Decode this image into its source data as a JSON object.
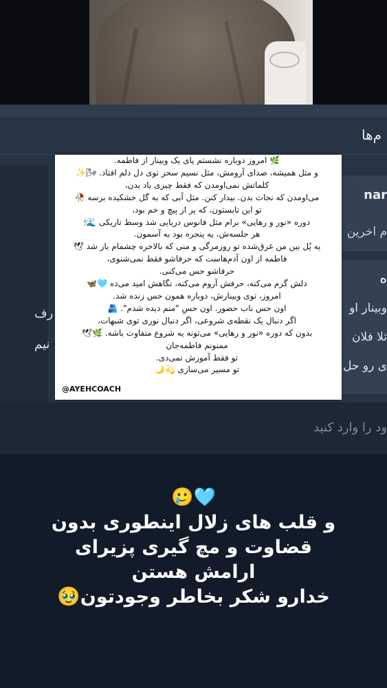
{
  "header": {
    "title": "م‌ها"
  },
  "chat_list": {
    "preview_name": "nar",
    "preview_message": "م اخرین"
  },
  "message_card": {
    "heading": "ه",
    "line1": "وبینار او",
    "line2": "ثلا فلان",
    "line3": "ی رو حل"
  },
  "left_fragments": {
    "line1": "رف",
    "line2": "نیم"
  },
  "input": {
    "placeholder": "ود را وارد کنید"
  },
  "quote_card": {
    "lines": [
      "🌿 امروز دوباره نشستم پای یک وبینار از فاطمه.",
      "و مثل همیشه، صدای آرومش، مثل نسیم سحر توی دل دلم افتاد. 🌬✨",
      "کلماتش نمی‌اومدن که فقط چیزی یاد بدن،",
      "می‌اومدن که نجات بدن. بیدار کنن. مثل آبی که به گل خشکیده برسه 🥀",
      "تو این تابستون، که پر از پیچ و خم بود،",
      "دوره «نور و رهایی» برام مثل فانوس دریایی شد وسط تاریکی 🌊🕯",
      "هر جلسه‌ش، یه پنجره بود به آسمون.",
      "یه پُل بین من غرق‌شده تو روزمرگی و منی که بالاخره چشمام باز شد 🕊",
      "فاطمه از اون آدم‌هاست که حرفاشو فقط نمی‌شنوی،",
      "حرفاشو حس می‌کنی.",
      "دلش گرم می‌کنه، حرفش آروم می‌کنه، نگاهش امید می‌ده 🩵🦋",
      "امروز، توی وبینارش، دوباره همون حس زنده شد.",
      "اون حس ناب حضور. اون حسِ \"منم دیده شدم\". 🫂",
      "اگر دنبال یک نقطه‌ی شروعی، اگر دنبال نوری توی شبهات،",
      "بدون که دوره «نور و رهایی» می‌تونه یه شروع متفاوت باشه. 🌿🕊",
      "ممنونم فاطمه‌جان",
      "تو فقط آموزش نمی‌دی.",
      "تو مسیر می‌سازی 💫🌙"
    ],
    "handle": "@AYEHCOACH"
  },
  "caption": {
    "emoji": "🥲🩵",
    "line1": "و قلب های زلال اینطوری بدون",
    "line2": "قضاوت و مچ گیری پزیرای",
    "line3": "ارامش هستن",
    "line4": "خدارو شکر بخاطر وجودتون🥹"
  },
  "colors": {
    "background": "#111b2a",
    "panel": "#273444",
    "card": "#334153",
    "quote_bg": "#ffffff"
  }
}
